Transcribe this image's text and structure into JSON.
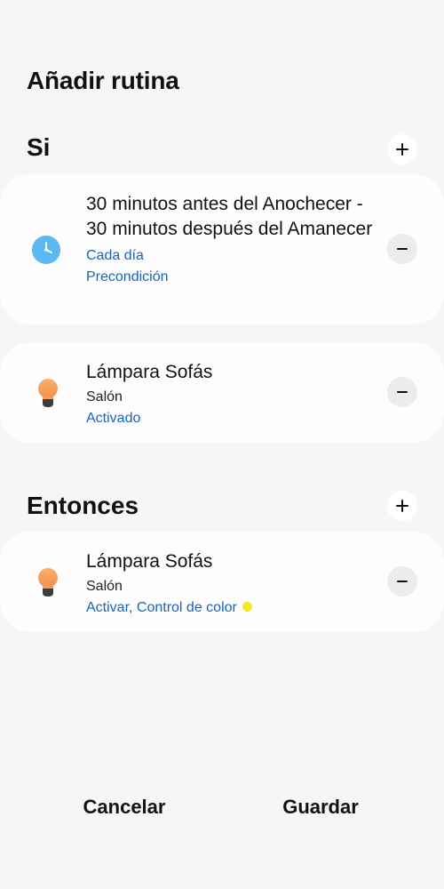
{
  "header": {
    "title": "Añadir rutina"
  },
  "if_section": {
    "title": "Si",
    "add_icon": "plus-icon",
    "conditions": [
      {
        "icon": "clock-icon",
        "title": "30 minutos antes del Anochecer - 30 minutos después del Amanecer",
        "link1": "Cada día",
        "link2": "Precondición"
      },
      {
        "icon": "lightbulb-icon",
        "title": "Lámpara Sofás",
        "subtitle": "Salón",
        "link1": "Activado"
      }
    ]
  },
  "then_section": {
    "title": "Entonces",
    "add_icon": "plus-icon",
    "actions": [
      {
        "icon": "lightbulb-icon",
        "title": "Lámpara Sofás",
        "subtitle": "Salón",
        "link1": "Activar, Control de color",
        "color": "#f4ea1f"
      }
    ]
  },
  "footer": {
    "cancel_label": "Cancelar",
    "save_label": "Guardar"
  },
  "colors": {
    "background": "#f6f6f6",
    "card": "#fdfdfd",
    "link": "#1565c0",
    "clock": "#5bb8f0",
    "bulb": "#f7a35c"
  }
}
